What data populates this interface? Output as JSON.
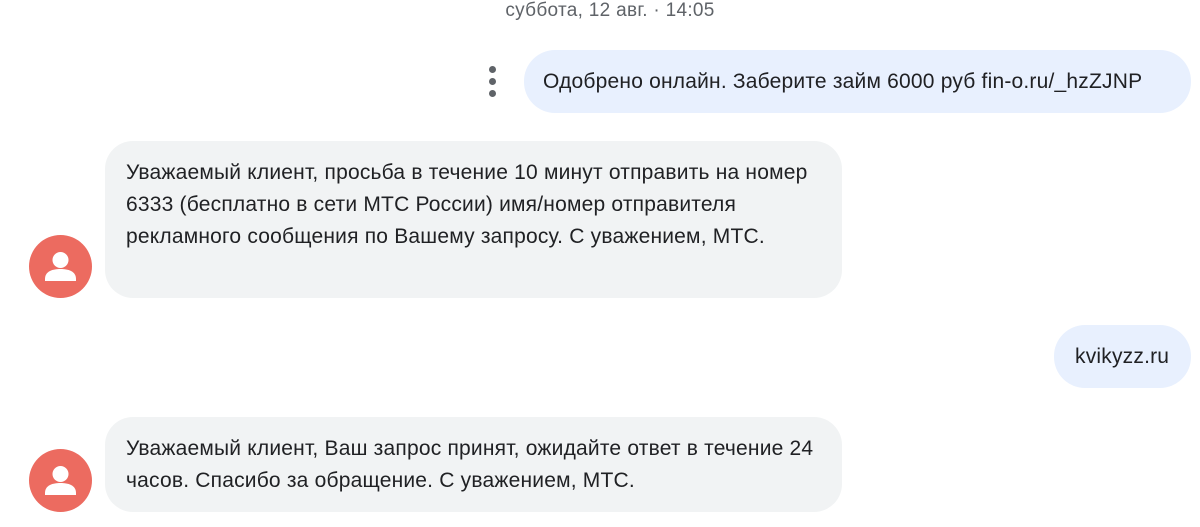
{
  "conversation": {
    "date_separator": "суббота, 12 авг. · 14:05",
    "messages": [
      {
        "direction": "outgoing",
        "text": "Одобрено онлайн. Заберите займ 6000 руб fin-o.ru/_hzZJNP"
      },
      {
        "direction": "incoming",
        "text": "Уважаемый клиент, просьба в течение 10 минут отправить на номер 6333 (бесплатно в сети МТС России) имя/номер отправителя рекламного сообщения по Вашему запросу. С уважением, МТС."
      },
      {
        "direction": "outgoing",
        "text": "kvikyzz.ru"
      },
      {
        "direction": "incoming",
        "text": "Уважаемый клиент, Ваш запрос принят, ожидайте ответ в течение 24 часов. Спасибо за обращение. С уважением, МТС."
      }
    ]
  },
  "icons": {
    "more_options": "more-vert-icon",
    "avatar": "person-icon"
  },
  "colors": {
    "outgoing_bubble": "#e8f0fe",
    "incoming_bubble": "#f1f3f4",
    "avatar_background": "#ec6b60",
    "timestamp_text": "#5f6368"
  }
}
